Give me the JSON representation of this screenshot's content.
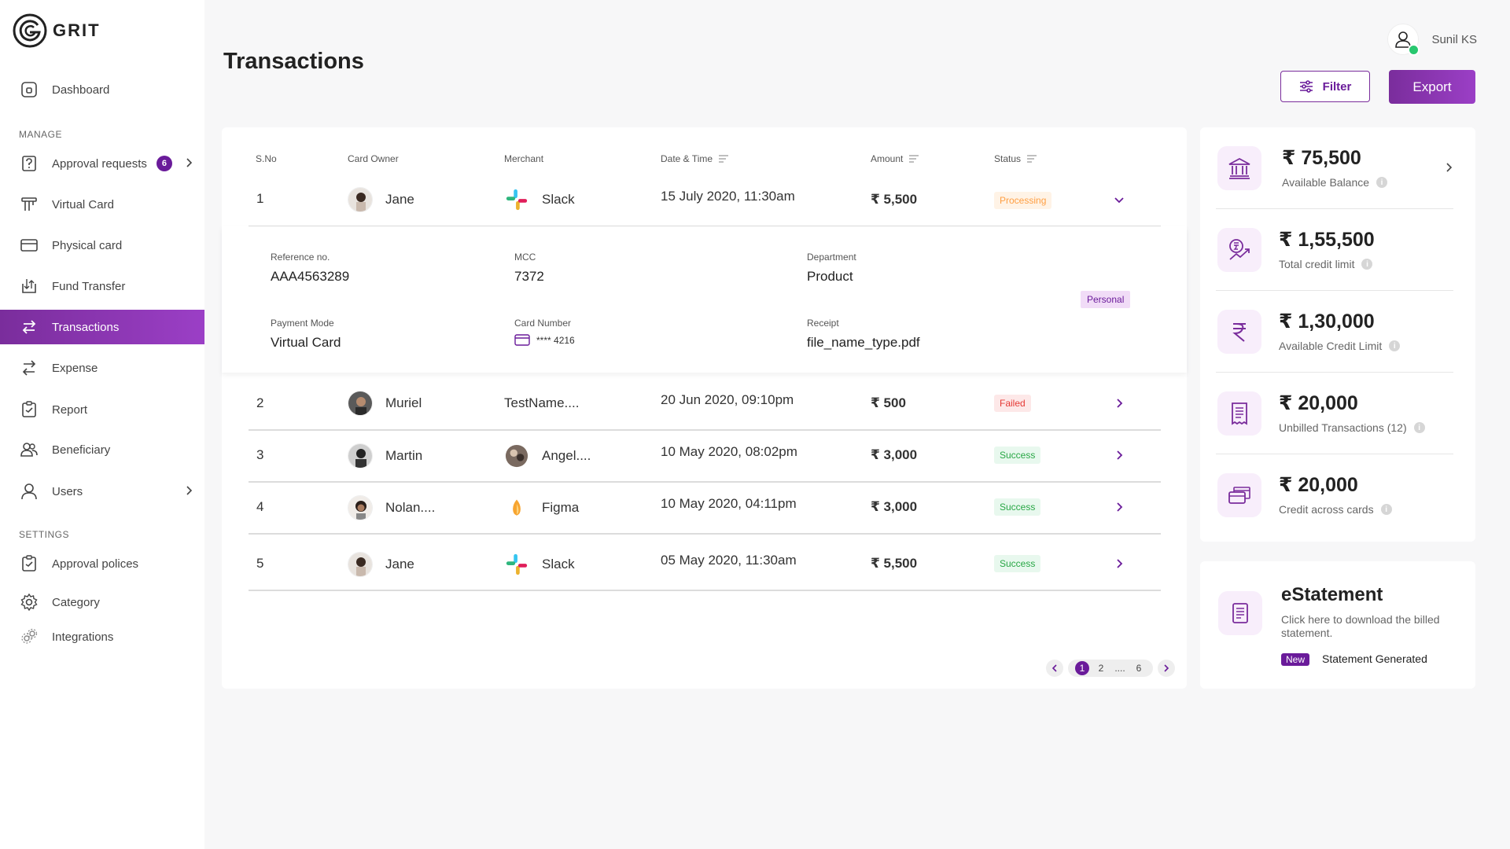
{
  "app": {
    "name": "GRIT"
  },
  "sidebar": {
    "sections": {
      "manage": "MANAGE",
      "settings": "SETTINGS"
    },
    "items": [
      {
        "label": "Dashboard",
        "icon": "dashboard-icon"
      },
      {
        "label": "Approval requests",
        "icon": "approval-icon",
        "badge": "6"
      },
      {
        "label": "Virtual Card",
        "icon": "virtual-card-icon"
      },
      {
        "label": "Physical card",
        "icon": "physical-card-icon"
      },
      {
        "label": "Fund Transfer",
        "icon": "fund-transfer-icon"
      },
      {
        "label": "Transactions",
        "icon": "transactions-icon",
        "active": true
      },
      {
        "label": "Expense",
        "icon": "expense-icon"
      },
      {
        "label": "Report",
        "icon": "report-icon"
      },
      {
        "label": "Beneficiary",
        "icon": "beneficiary-icon"
      },
      {
        "label": "Users",
        "icon": "users-icon"
      },
      {
        "label": "Approval polices",
        "icon": "approval-policies-icon"
      },
      {
        "label": "Category",
        "icon": "category-icon"
      },
      {
        "label": "Integrations",
        "icon": "integrations-icon"
      }
    ]
  },
  "header": {
    "title": "Transactions",
    "user_name": "Sunil KS",
    "filter_label": "Filter",
    "export_label": "Export"
  },
  "table": {
    "columns": [
      "S.No",
      "Card Owner",
      "Merchant",
      "Date & Time",
      "Amount",
      "Status"
    ],
    "rows": [
      {
        "sno": "1",
        "owner": "Jane",
        "merchant": "Slack",
        "datetime": "15 July 2020, 11:30am",
        "amount": "₹ 5,500",
        "status": "Processing"
      },
      {
        "sno": "2",
        "owner": "Muriel",
        "merchant": "TestName....",
        "datetime": "20 Jun 2020, 09:10pm",
        "amount": "₹ 500",
        "status": "Failed"
      },
      {
        "sno": "3",
        "owner": "Martin",
        "merchant": "Angel....",
        "datetime": "10 May 2020, 08:02pm",
        "amount": "₹ 3,000",
        "status": "Success"
      },
      {
        "sno": "4",
        "owner": "Nolan....",
        "merchant": "Figma",
        "datetime": "10 May 2020, 04:11pm",
        "amount": "₹ 3,000",
        "status": "Success"
      },
      {
        "sno": "5",
        "owner": "Jane",
        "merchant": "Slack",
        "datetime": "05 May 2020, 11:30am",
        "amount": "₹ 5,500",
        "status": "Success"
      }
    ],
    "expanded": {
      "reference_label": "Reference no.",
      "reference_value": "AAA4563289",
      "mcc_label": "MCC",
      "mcc_value": "7372",
      "department_label": "Department",
      "department_value": "Product",
      "tag": "Personal",
      "payment_mode_label": "Payment Mode",
      "payment_mode_value": "Virtual Card",
      "card_number_label": "Card Number",
      "card_number_value": "**** 4216",
      "receipt_label": "Receipt",
      "receipt_value": "file_name_type.pdf"
    },
    "pagination": {
      "pages": [
        "1",
        "2",
        "....",
        "6"
      ],
      "current": "1"
    }
  },
  "stats": [
    {
      "value": "₹ 75,500",
      "label": "Available Balance",
      "icon": "bank-icon"
    },
    {
      "value": "₹ 1,55,500",
      "label": "Total credit limit",
      "icon": "credit-growth-icon"
    },
    {
      "value": "₹ 1,30,000",
      "label": "Available Credit Limit",
      "icon": "rupee-icon"
    },
    {
      "value": "₹ 20,000",
      "label": "Unbilled Transactions (12)",
      "icon": "receipt-icon"
    },
    {
      "value": "₹ 20,000",
      "label": "Credit across cards",
      "icon": "cards-icon"
    }
  ],
  "estatement": {
    "title": "eStatement",
    "description": "Click here to download the billed statement.",
    "new_badge": "New",
    "status": "Statement Generated"
  },
  "colors": {
    "accent": "#7a2d9c",
    "accent_dark": "#6a1b9a",
    "processing": "#ff9f43",
    "failed": "#e53935",
    "success": "#28a745"
  }
}
